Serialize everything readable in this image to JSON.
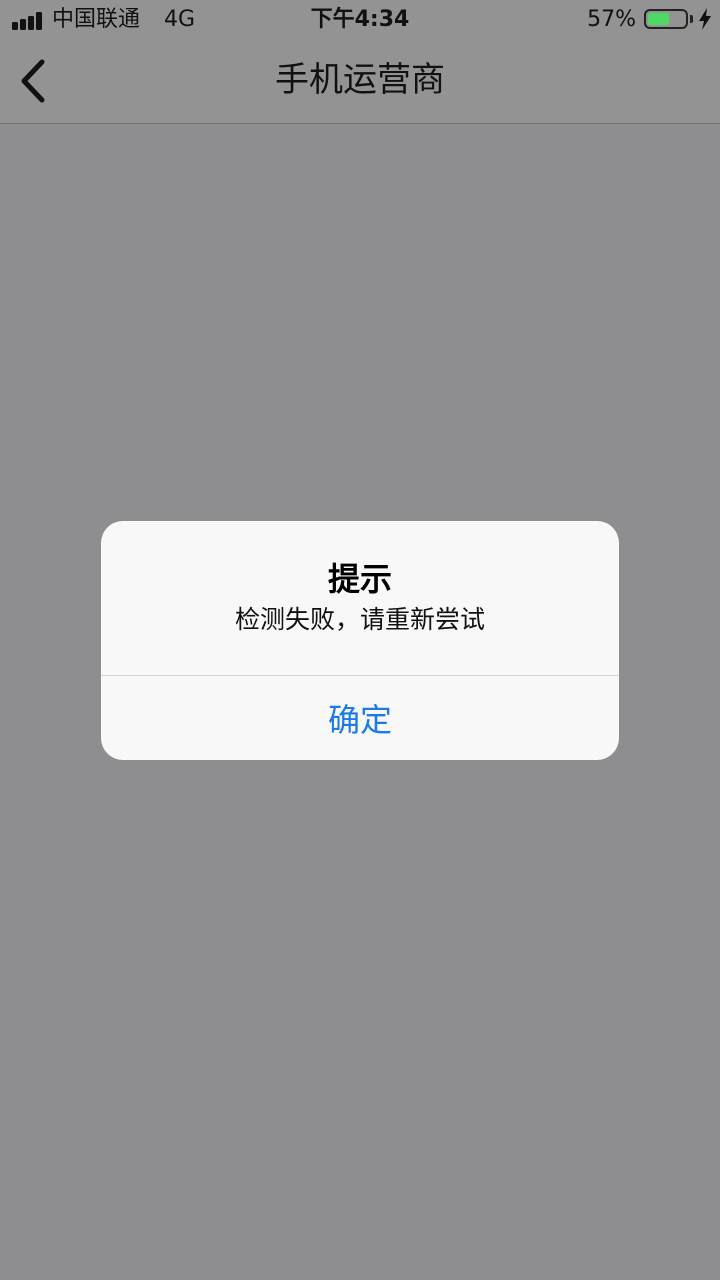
{
  "status_bar": {
    "carrier": "中国联通",
    "network": "4G",
    "time": "下午4:34",
    "battery_percent_label": "57%",
    "battery_level": 0.57,
    "battery_color": "#4cd964",
    "signal_icon": "signal-bars-icon",
    "charging_icon": "lightning-bolt-icon"
  },
  "nav": {
    "title": "手机运营商",
    "back_icon": "chevron-left-icon"
  },
  "alert": {
    "title": "提示",
    "message": "检测失败，请重新尝试",
    "confirm_label": "确定",
    "confirm_color": "#1a7ae8"
  }
}
